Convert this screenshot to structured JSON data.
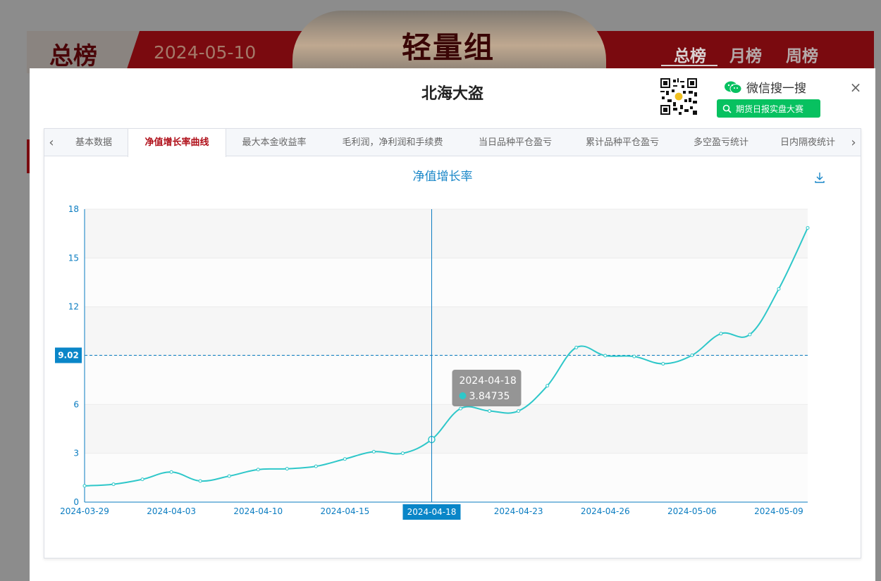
{
  "background": {
    "left_title": "总榜",
    "date": "2024-05-10",
    "center_title": "轻量组",
    "nav": [
      "总榜",
      "月榜",
      "周榜"
    ]
  },
  "modal": {
    "title": "北海大盗",
    "wechat_label": "微信搜一搜",
    "search_button": "期货日报实盘大赛",
    "close": "×"
  },
  "tabs": [
    {
      "label": "基本数据",
      "active": false
    },
    {
      "label": "净值增长率曲线",
      "active": true
    },
    {
      "label": "最大本金收益率",
      "active": false
    },
    {
      "label": "毛利润，净利润和手续费",
      "active": false
    },
    {
      "label": "当日品种平仓盈亏",
      "active": false
    },
    {
      "label": "累计品种平仓盈亏",
      "active": false
    },
    {
      "label": "多空盈亏统计",
      "active": false
    },
    {
      "label": "日内隔夜统计",
      "active": false
    }
  ],
  "colors": {
    "accent_red": "#b0101a",
    "line": "#2ec7c9",
    "axis": "#0a7cc1",
    "wechat_green": "#07c160"
  },
  "chart_data": {
    "type": "line",
    "title": "净值增长率",
    "ylim": [
      0,
      18
    ],
    "yticks": [
      0,
      3,
      6,
      12,
      15,
      18
    ],
    "x_tick_labels": [
      "2024-03-29",
      "2024-04-03",
      "2024-04-10",
      "2024-04-15",
      "2024-04-23",
      "2024-04-26",
      "2024-05-06",
      "2024-05-09"
    ],
    "x": [
      "2024-03-29",
      "2024-04-01",
      "2024-04-02",
      "2024-04-03",
      "2024-04-08",
      "2024-04-09",
      "2024-04-10",
      "2024-04-11",
      "2024-04-12",
      "2024-04-15",
      "2024-04-16",
      "2024-04-17",
      "2024-04-18",
      "2024-04-19",
      "2024-04-22",
      "2024-04-23",
      "2024-04-24",
      "2024-04-25",
      "2024-04-26",
      "2024-04-29",
      "2024-04-30",
      "2024-05-06",
      "2024-05-07",
      "2024-05-08",
      "2024-05-09",
      "2024-05-10"
    ],
    "values": [
      1.0,
      1.1,
      1.4,
      1.85,
      1.3,
      1.6,
      2.0,
      2.05,
      2.2,
      2.65,
      3.1,
      3.0,
      3.84735,
      5.75,
      5.6,
      5.6,
      7.15,
      9.5,
      9.0,
      8.95,
      8.5,
      9.02,
      10.35,
      10.3,
      13.1,
      16.85
    ],
    "highlight_value": "9.02",
    "tooltip": {
      "date": "2024-04-18",
      "value": "3.84735"
    },
    "grid": "horizontal",
    "legend": "none"
  }
}
